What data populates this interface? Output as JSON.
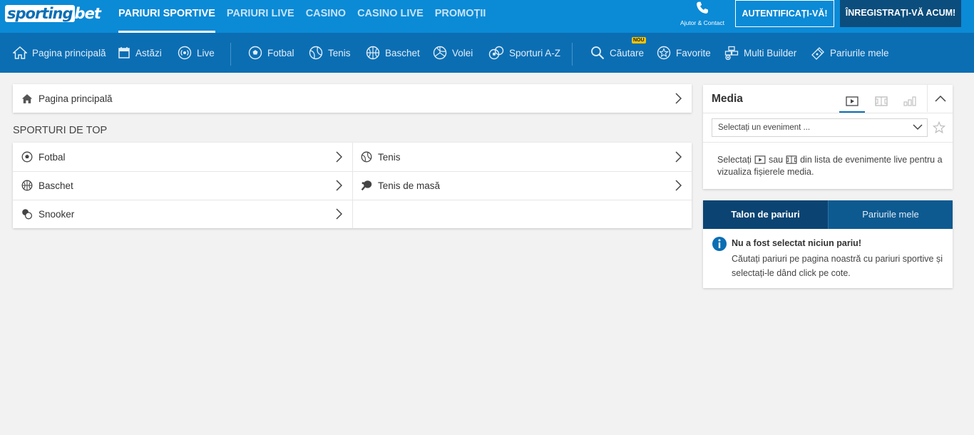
{
  "brand": {
    "logo_a": "sporting",
    "logo_b": "bet"
  },
  "topnav": [
    {
      "label": "PARIURI SPORTIVE",
      "active": true
    },
    {
      "label": "PARIURI LIVE"
    },
    {
      "label": "CASINO"
    },
    {
      "label": "CASINO LIVE"
    },
    {
      "label": "PROMOȚII"
    }
  ],
  "header": {
    "help_label": "Ajutor & Contact",
    "login_label": "AUTENTIFICAȚI-VĂ!",
    "register_label": "ÎNREGISTRAȚI-VĂ ACUM!"
  },
  "subnav": {
    "home": "Pagina principală",
    "today": "Astăzi",
    "live": "Live",
    "football": "Fotbal",
    "tennis": "Tenis",
    "basketball": "Baschet",
    "volleyball": "Volei",
    "sports_az": "Sporturi A-Z",
    "search": "Căutare",
    "search_badge": "NOU",
    "favorites": "Favorite",
    "multi_builder": "Multi Builder",
    "my_bets": "Pariurile mele"
  },
  "breadcrumb": {
    "label": "Pagina principală"
  },
  "top_sports": {
    "title": "SPORTURI DE TOP",
    "items": [
      {
        "label": "Fotbal",
        "icon": "football-icon"
      },
      {
        "label": "Tenis",
        "icon": "tennis-icon"
      },
      {
        "label": "Baschet",
        "icon": "basketball-icon"
      },
      {
        "label": "Tenis de masă",
        "icon": "table-tennis-icon"
      },
      {
        "label": "Snooker",
        "icon": "snooker-icon"
      }
    ]
  },
  "media": {
    "title": "Media",
    "select_placeholder": "Selectați un eveniment ...",
    "msg_a": "Selectați",
    "msg_b": "sau",
    "msg_c": "din lista de evenimente live pentru a vizualiza fișierele media."
  },
  "betslip": {
    "tab_slip": "Talon de pariuri",
    "tab_mybets": "Pariurile mele",
    "empty_title": "Nu a fost selectat niciun pariu!",
    "empty_text": "Căutați pariuri pe pagina noastră cu pariuri sportive și selectați-le dând click pe cote."
  },
  "colors": {
    "primary": "#0b8ad6",
    "subnav": "#0b6eb3",
    "dark": "#0b4d7c",
    "background": "#f2f2f2"
  }
}
